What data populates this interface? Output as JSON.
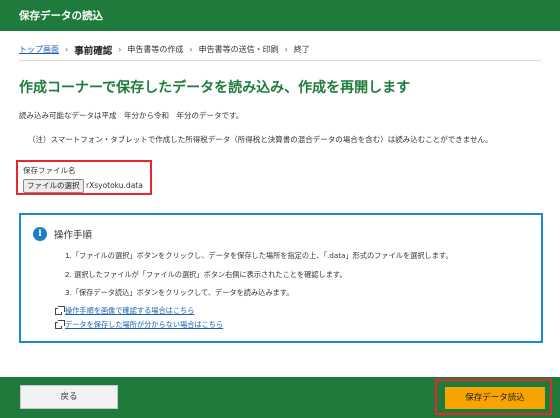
{
  "header": {
    "title": "保存データの読込"
  },
  "breadcrumb": {
    "items": [
      {
        "label": "トップ画面"
      },
      {
        "label": "事前確認"
      },
      {
        "label": "申告書等の作成"
      },
      {
        "label": "申告書等の送信・印刷"
      },
      {
        "label": "終了"
      }
    ],
    "separator": "›"
  },
  "main": {
    "title": "作成コーナーで保存したデータを読み込み、作成を再開します",
    "desc1": "読み込み可能なデータは平成　年分から令和　年分のデータです。",
    "desc2": "（注）スマートフォン・タブレットで作成した所得税データ（所得税と決算書の混合データの場合を含む）は読み込むことができません。",
    "file": {
      "label": "保存ファイル名",
      "button": "ファイルの選択",
      "filename": "rXsyotoku.data"
    }
  },
  "info": {
    "icon": "info-icon",
    "icon_glyph": "i",
    "title": "操作手順",
    "steps": [
      "1.「ファイルの選択」ボタンをクリックし、データを保存した場所を指定の上、「.data」形式のファイルを選択します。",
      "2. 選択したファイルが「ファイルの選択」ボタン右側に表示されたことを確認します。",
      "3.「保存データ読込」ボタンをクリックして、データを読み込みます。"
    ],
    "links": [
      {
        "icon": "external-link-icon",
        "label": "操作手順を画像で確認する場合はこちら"
      },
      {
        "icon": "external-link-icon",
        "label": "データを保存した場所が分からない場合はこちら"
      }
    ]
  },
  "footer": {
    "back": "戻る",
    "load": "保存データ読込"
  },
  "colors": {
    "header_green": "#1e7b3c",
    "title_green": "#1e7b3c",
    "info_border": "#1b8bd0",
    "highlight_red": "#e8262c",
    "load_button": "#f7a400",
    "link_blue": "#1a5fb4"
  }
}
